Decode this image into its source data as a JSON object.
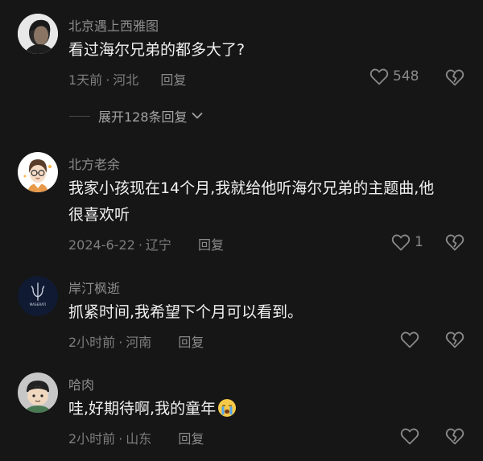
{
  "comments": [
    {
      "username": "北京遇上西雅图",
      "text": "看过海尔兄弟的都多大了?",
      "time": "1天前",
      "location": "河北",
      "reply_label": "回复",
      "likes": "548"
    },
    {
      "username": "北方老余",
      "text": "我家小孩现在14个月,我就给他听海尔兄弟的主题曲,他很喜欢听",
      "time": "2024-6-22",
      "location": "辽宁",
      "reply_label": "回复",
      "likes": "1"
    },
    {
      "username": "岸汀枫逝",
      "text": "抓紧时间,我希望下个月可以看到。",
      "time": "2小时前",
      "location": "河南",
      "reply_label": "回复",
      "likes": ""
    },
    {
      "username": "哈肉",
      "text": "哇,好期待啊,我的童年",
      "time": "2小时前",
      "location": "山东",
      "reply_label": "回复",
      "likes": ""
    }
  ],
  "expand_replies": {
    "label": "展开128条回复"
  },
  "meta_separator": "·",
  "avatar_brand_text": "MASERATI",
  "icons": {
    "like": "heart-outline-icon",
    "dislike": "broken-heart-icon",
    "expand": "chevron-down-icon",
    "emoji": "crying-face-emoji"
  },
  "colors": {
    "background": "#161616",
    "primary_text": "#f0f0f0",
    "secondary_text": "#8d8d8d"
  }
}
